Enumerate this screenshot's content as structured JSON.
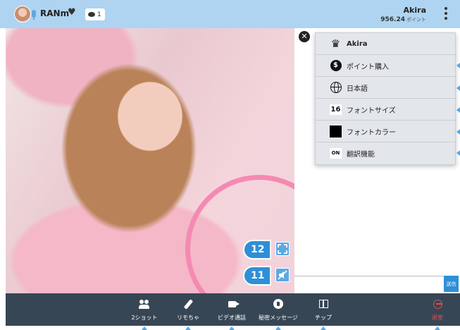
{
  "header": {
    "username": "RANm",
    "chat_count": "1",
    "account_name": "Akira",
    "points_value": "956.24",
    "points_unit": "ポイント"
  },
  "menu": {
    "items": [
      {
        "label": "Akira",
        "icon": "crown-icon"
      },
      {
        "label": "ポイント購入",
        "icon": "dollar-icon"
      },
      {
        "label": "日本語",
        "icon": "globe-icon"
      },
      {
        "label": "フォントサイズ",
        "icon": "font-size-16-icon",
        "icon_text": "16"
      },
      {
        "label": "フォントカラー",
        "icon": "black-swatch-icon",
        "swatch_color": "#000000"
      },
      {
        "label": "翻訳機能",
        "icon": "toggle-on-icon",
        "icon_text": "ON"
      }
    ]
  },
  "video": {
    "callouts": [
      "12",
      "11"
    ]
  },
  "chat": {
    "send_label": "送信"
  },
  "toolbar": {
    "items": [
      {
        "label": "2ショット",
        "icon": "two-users-icon"
      },
      {
        "label": "リモちゃ",
        "icon": "remote-toy-icon"
      },
      {
        "label": "ビデオ通話",
        "icon": "video-camera-icon"
      },
      {
        "label": "秘密メッセージ",
        "icon": "secret-lock-icon"
      },
      {
        "label": "チップ",
        "icon": "gift-icon"
      },
      {
        "label": "退室",
        "icon": "exit-icon"
      }
    ]
  },
  "colors": {
    "header_bg": "#aed4f1",
    "accent": "#2f8fd6",
    "toolbar_bg": "#374655",
    "exit_red": "#e14d4d",
    "menu_bg": "#e3e6ea"
  }
}
